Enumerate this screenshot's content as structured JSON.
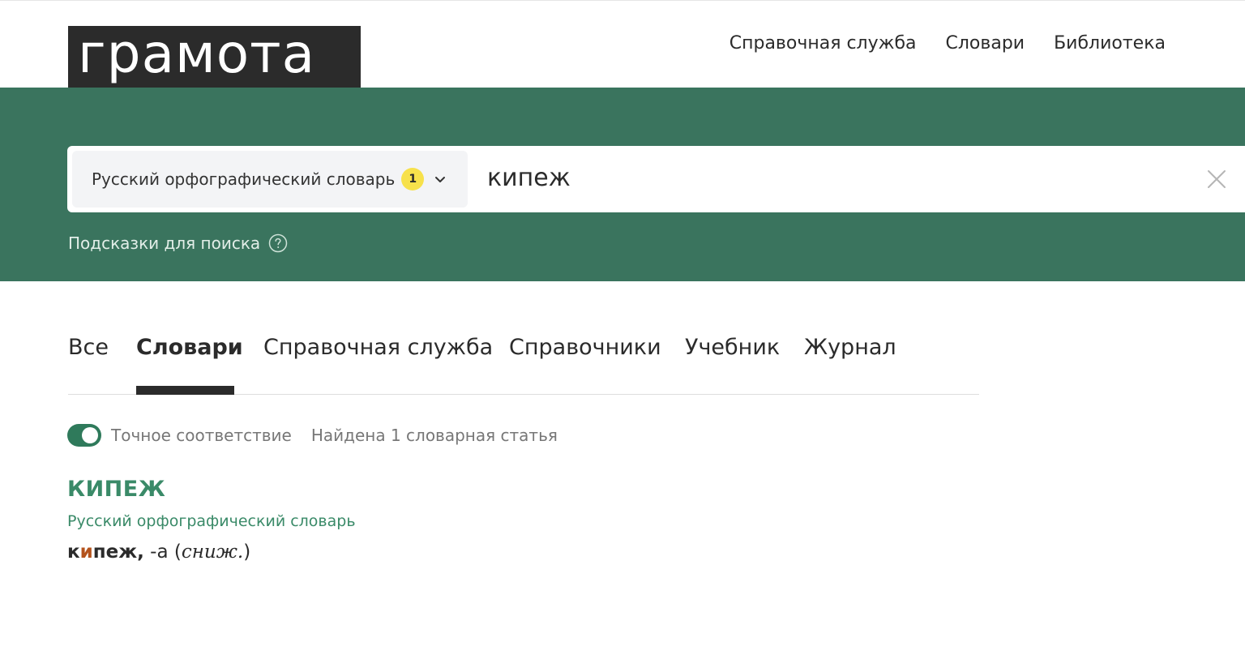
{
  "header": {
    "logo_text": "грамота",
    "nav": [
      "Справочная служба",
      "Словари",
      "Библиотека"
    ]
  },
  "search": {
    "dictionary": "Русский орфографический словарь",
    "dictionary_count": "1",
    "query": "кипеж",
    "hints_label": "Подсказки для поиска"
  },
  "tabs": {
    "items": [
      "Все",
      "Словари",
      "Справочная служба",
      "Справочники",
      "Учебник",
      "Журнал"
    ],
    "active": "Словари"
  },
  "filters": {
    "exact_match_label": "Точное соответствие",
    "exact_match_on": true,
    "found_text": "Найдена 1 словарная статья"
  },
  "entry": {
    "headword": "КИПЕЖ",
    "source": "Русский орфографический словарь",
    "word_pre": "к",
    "word_stress": "и",
    "word_post": "пеж,",
    "form": " -а (",
    "note": "сниж.",
    "close": ")"
  },
  "colors": {
    "hero": "#3a745e",
    "accent": "#3a8a68",
    "badge": "#f7e14b",
    "stress": "#b4531c"
  }
}
